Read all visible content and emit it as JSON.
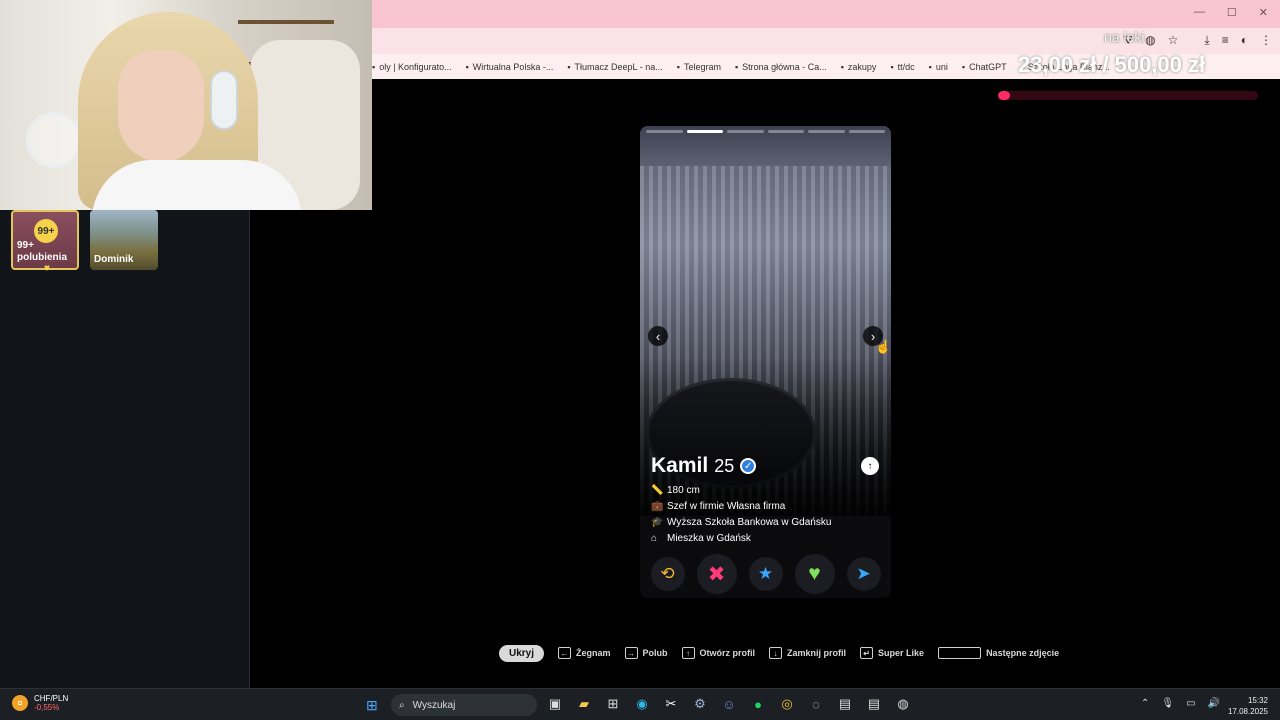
{
  "browser": {
    "overlay_label": "na leki",
    "bookmarks": [
      {
        "label": "oly | Konfigurato..."
      },
      {
        "label": "Wirtualna Polska -..."
      },
      {
        "label": "Tłumacz DeepL - na..."
      },
      {
        "label": "Telegram"
      },
      {
        "label": "Strona główna - Ca..."
      },
      {
        "label": "zakupy"
      },
      {
        "label": "tt/dc"
      },
      {
        "label": "uni"
      },
      {
        "label": "ChatGPT"
      },
      {
        "label": "Szkoła Loga Bianz..."
      }
    ]
  },
  "donation": {
    "text": "23,00 zł / 500,00 zł",
    "progress": 0.046
  },
  "sidebar": {
    "likes_badge": "99+",
    "likes_label_1": "99+",
    "likes_label_2": "polubienia",
    "match_name": "Dominik"
  },
  "profile": {
    "name": "Kamil",
    "age": "25",
    "photo_count": 6,
    "photo_index": 2,
    "facts": [
      {
        "icon": "ruler-icon",
        "text": "180 cm"
      },
      {
        "icon": "briefcase-icon",
        "text": "Szef w firmie Własna firma"
      },
      {
        "icon": "graduation-cap-icon",
        "text": "Wyższa Szkoła Bankowa w Gdańsku"
      },
      {
        "icon": "home-icon",
        "text": "Mieszka w Gdańsk"
      }
    ]
  },
  "hints": {
    "hide": "Ukryj",
    "nope": "Żegnam",
    "like": "Polub",
    "open_profile": "Otwórz profil",
    "close_profile": "Zamknij profil",
    "super_like": "Super Like",
    "next_photo": "Następne zdjęcie"
  },
  "taskbar": {
    "ticker_pair": "CHF/PLN",
    "ticker_change": "-0,55%",
    "search_placeholder": "Wyszukaj",
    "time": "15:32",
    "date": "17.08.2025"
  },
  "colors": {
    "accent_pink": "#f7c4d0",
    "nope": "#ff3c7a",
    "like": "#7ee05b",
    "super": "#3aa4ff",
    "rewind": "#f5b92d"
  }
}
